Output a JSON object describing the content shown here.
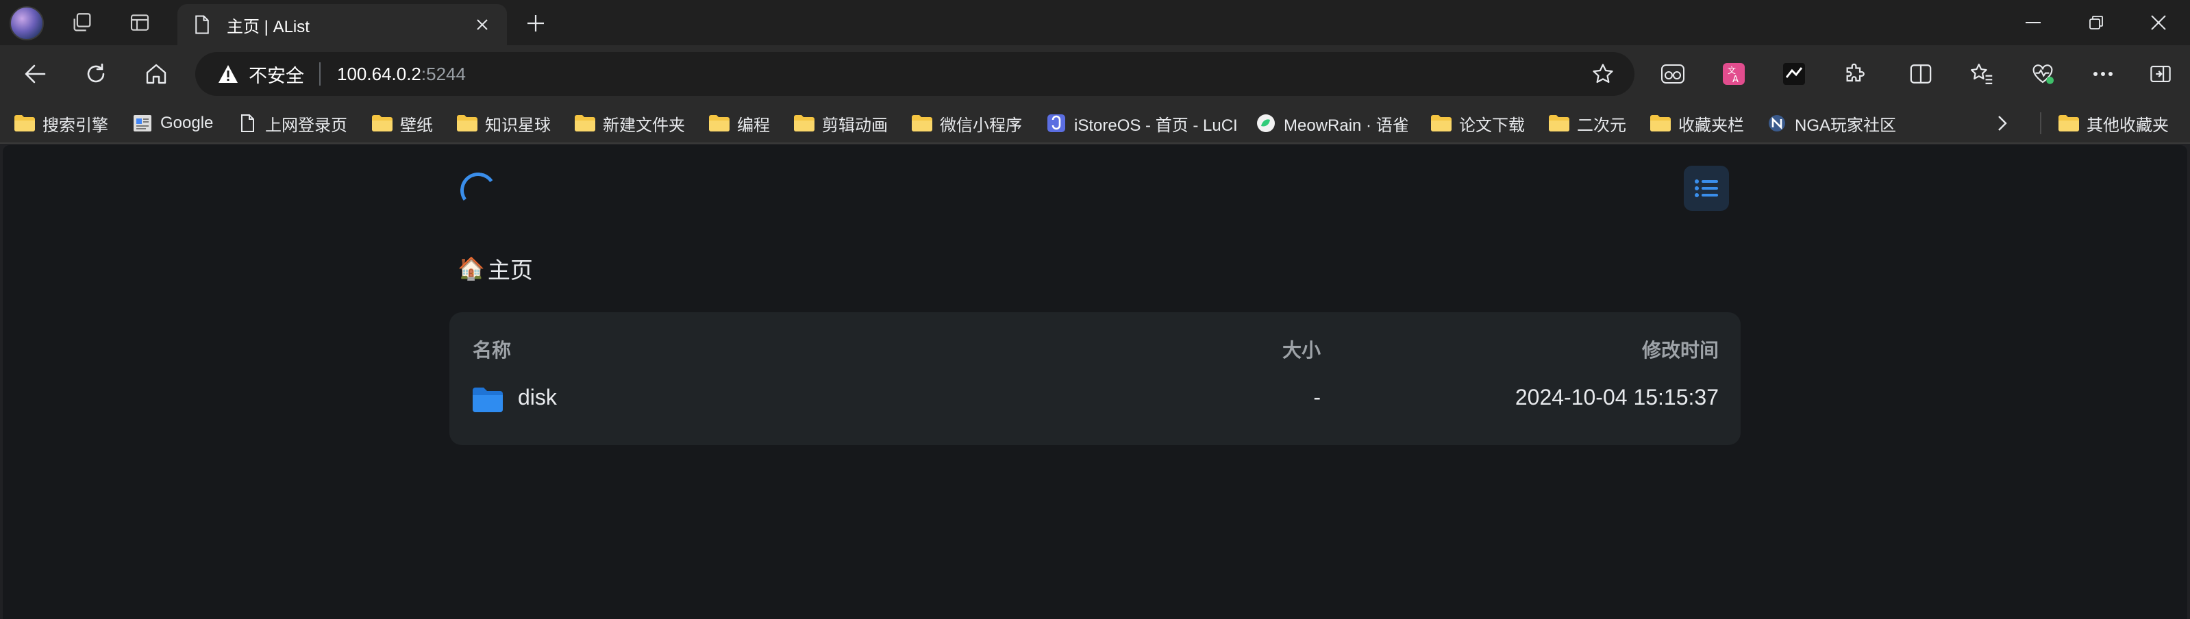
{
  "browser": {
    "tab": {
      "title": "主页 | AList",
      "icon": "page-icon"
    },
    "address": {
      "security_label": "不安全",
      "host": "100.64.0.2",
      "port": ":5244"
    },
    "icons": {
      "profile": "profile-avatar",
      "workspaces": "workspaces-icon",
      "tab_actions": "tab-actions-icon",
      "close_tab": "close-icon",
      "new_tab": "plus-icon",
      "back": "back-arrow-icon",
      "refresh": "refresh-icon",
      "home": "home-icon",
      "favorite": "star-icon",
      "minimize": "minimize-icon",
      "restore": "restore-icon",
      "close_window": "close-icon"
    },
    "extensions": [
      "reader-icon",
      "translate-icon",
      "ext-icon",
      "extensions-puzzle-icon",
      "split-screen-icon",
      "favorites-icon",
      "health-icon",
      "more-icon",
      "sidebar-icon"
    ]
  },
  "bookmarks": {
    "items": [
      {
        "label": "搜索引擎",
        "icon": "folder-icon"
      },
      {
        "label": "Google",
        "icon": "google-page-icon"
      },
      {
        "label": "上网登录页",
        "icon": "page-icon"
      },
      {
        "label": "壁纸",
        "icon": "folder-icon"
      },
      {
        "label": "知识星球",
        "icon": "folder-icon"
      },
      {
        "label": "新建文件夹",
        "icon": "folder-icon"
      },
      {
        "label": "编程",
        "icon": "folder-icon"
      },
      {
        "label": "剪辑动画",
        "icon": "folder-icon"
      },
      {
        "label": "微信小程序",
        "icon": "folder-icon"
      },
      {
        "label": "iStoreOS - 首页 - LuCI",
        "icon": "istore-icon"
      },
      {
        "label": "MeowRain · 语雀",
        "icon": "yuque-icon"
      },
      {
        "label": "论文下载",
        "icon": "folder-icon"
      },
      {
        "label": "二次元",
        "icon": "folder-icon"
      },
      {
        "label": "收藏夹栏",
        "icon": "folder-icon"
      },
      {
        "label": "NGA玩家社区",
        "icon": "nga-icon"
      }
    ],
    "overflow_icon": "chevron-right-icon",
    "other": {
      "label": "其他收藏夹",
      "icon": "folder-icon"
    }
  },
  "page": {
    "breadcrumb": {
      "icon": "🏠",
      "label": "主页"
    },
    "list": {
      "headers": {
        "name": "名称",
        "size": "大小",
        "modified": "修改时间"
      },
      "rows": [
        {
          "name": "disk",
          "size": "-",
          "modified": "2024-10-04 15:15:37",
          "icon": "folder-icon"
        }
      ]
    }
  },
  "colors": {
    "accent": "#3a8eeb",
    "folder_blue": "#2f8cf0",
    "bookmark_folder": "#f5c542",
    "page_bg": "#16181b",
    "card_bg": "#202427"
  }
}
